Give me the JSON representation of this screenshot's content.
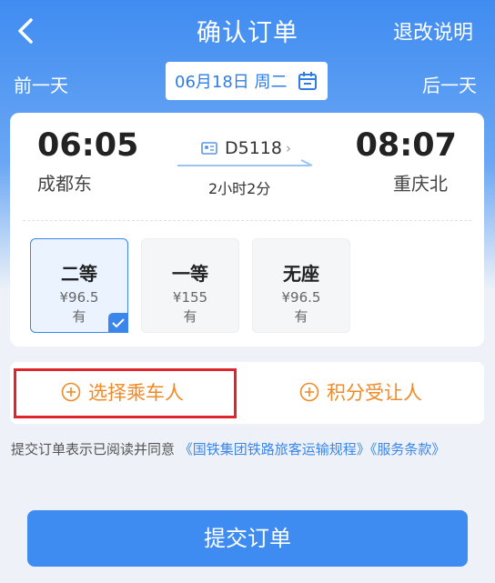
{
  "header": {
    "title": "确认订单",
    "refund_label": "退改说明"
  },
  "date_row": {
    "prev_label": "前一天",
    "date_label": "06月18日 周二",
    "next_label": "后一天"
  },
  "trip": {
    "depart_time": "06:05",
    "depart_station": "成都东",
    "train_number": "D5118",
    "chevron": "›",
    "duration": "2小时2分",
    "arrive_time": "08:07",
    "arrive_station": "重庆北"
  },
  "seats": [
    {
      "class": "二等",
      "price": "¥96.5",
      "availability": "有",
      "selected": true
    },
    {
      "class": "一等",
      "price": "¥155",
      "availability": "有",
      "selected": false
    },
    {
      "class": "无座",
      "price": "¥96.5",
      "availability": "有",
      "selected": false
    }
  ],
  "passenger": {
    "select_label": "选择乘车人",
    "points_label": "积分受让人"
  },
  "agreement": {
    "prefix": "提交订单表示已阅读并同意",
    "link1": "《国铁集团铁路旅客运输规程》",
    "link2": "《服务条款》"
  },
  "submit_label": "提交订单",
  "colors": {
    "primary": "#3e8cf2",
    "accent_orange": "#f08a24",
    "highlight_red": "#e0242b"
  }
}
